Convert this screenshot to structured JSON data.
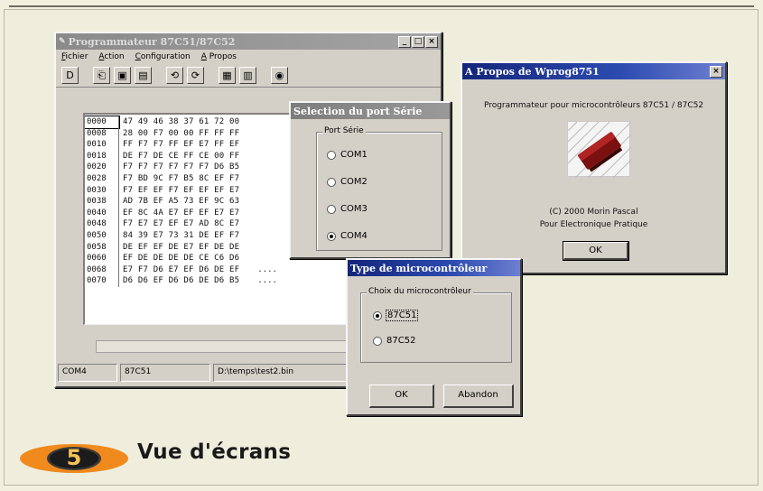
{
  "programmer_window": {
    "title": "Programmateur 87C51/87C52",
    "controls": {
      "minimize": "_",
      "maximize": "□",
      "close": "×"
    },
    "menu": [
      "Fichier",
      "Action",
      "Configuration",
      "A Propos"
    ],
    "toolbar_icons": [
      "new-file-icon",
      "open-file-icon",
      "save-icon",
      "save-as-icon",
      "read-chip-icon",
      "write-chip-icon",
      "verify-icon",
      "erase-icon",
      "info-icon"
    ],
    "hex_rows": [
      {
        "addr": "0000",
        "bytes": "47 49 46 38 37 61 72 00"
      },
      {
        "addr": "0008",
        "bytes": "28 00 F7 00 00 FF FF FF"
      },
      {
        "addr": "0010",
        "bytes": "FF F7 F7 FF EF E7 FF EF"
      },
      {
        "addr": "0018",
        "bytes": "DE F7 DE CE FF CE 00 FF"
      },
      {
        "addr": "0020",
        "bytes": "F7 F7 F7 F7 F7 F7 D6 B5"
      },
      {
        "addr": "0028",
        "bytes": "F7 BD 9C F7 B5 8C EF F7"
      },
      {
        "addr": "0030",
        "bytes": "F7 EF EF F7 EF EF EF E7"
      },
      {
        "addr": "0038",
        "bytes": "AD 7B EF A5 73 EF 9C 63"
      },
      {
        "addr": "0040",
        "bytes": "EF 8C 4A E7 EF EF E7 E7"
      },
      {
        "addr": "0048",
        "bytes": "F7 E7 E7 EF E7 AD 8C E7"
      },
      {
        "addr": "0050",
        "bytes": "84 39 E7 73 31 DE EF F7"
      },
      {
        "addr": "0058",
        "bytes": "DE EF EF DE E7 EF DE DE"
      },
      {
        "addr": "0060",
        "bytes": "EF DE DE DE DE CE C6 D6"
      },
      {
        "addr": "0068",
        "bytes": "E7 F7 D6 E7 EF D6 DE EF",
        "ascii": "...."
      },
      {
        "addr": "0070",
        "bytes": "D6 D6 EF D6 D6 DE D6 B5",
        "ascii": "...."
      }
    ],
    "status": {
      "port": "COM4",
      "chip": "87C51",
      "file": "D:\\temps\\test2.bin"
    }
  },
  "serial_port_dialog": {
    "title": "Selection du port Série",
    "group_label": "Port Série",
    "options": [
      {
        "label": "COM1",
        "selected": false
      },
      {
        "label": "COM2",
        "selected": false
      },
      {
        "label": "COM3",
        "selected": false
      },
      {
        "label": "COM4",
        "selected": true
      }
    ]
  },
  "about_dialog": {
    "title": "A Propos de Wprog8751",
    "close": "×",
    "description": "Programmateur pour microcontrôleurs 87C51 / 87C52",
    "copyright": "(C) 2000 Morin Pascal",
    "publication": "Pour Electronique Pratique",
    "ok_label": "OK",
    "chip_image": "microcontroller-chip-icon"
  },
  "micro_dialog": {
    "title": "Type de microcontrôleur",
    "group_label": "Choix du microcontrôleur",
    "options": [
      {
        "label": "87C51",
        "selected": true
      },
      {
        "label": "87C52",
        "selected": false
      }
    ],
    "ok_label": "OK",
    "cancel_label": "Abandon"
  },
  "caption": {
    "number": "5",
    "text": "Vue d'écrans",
    "badge_color": "#f08a1c"
  }
}
